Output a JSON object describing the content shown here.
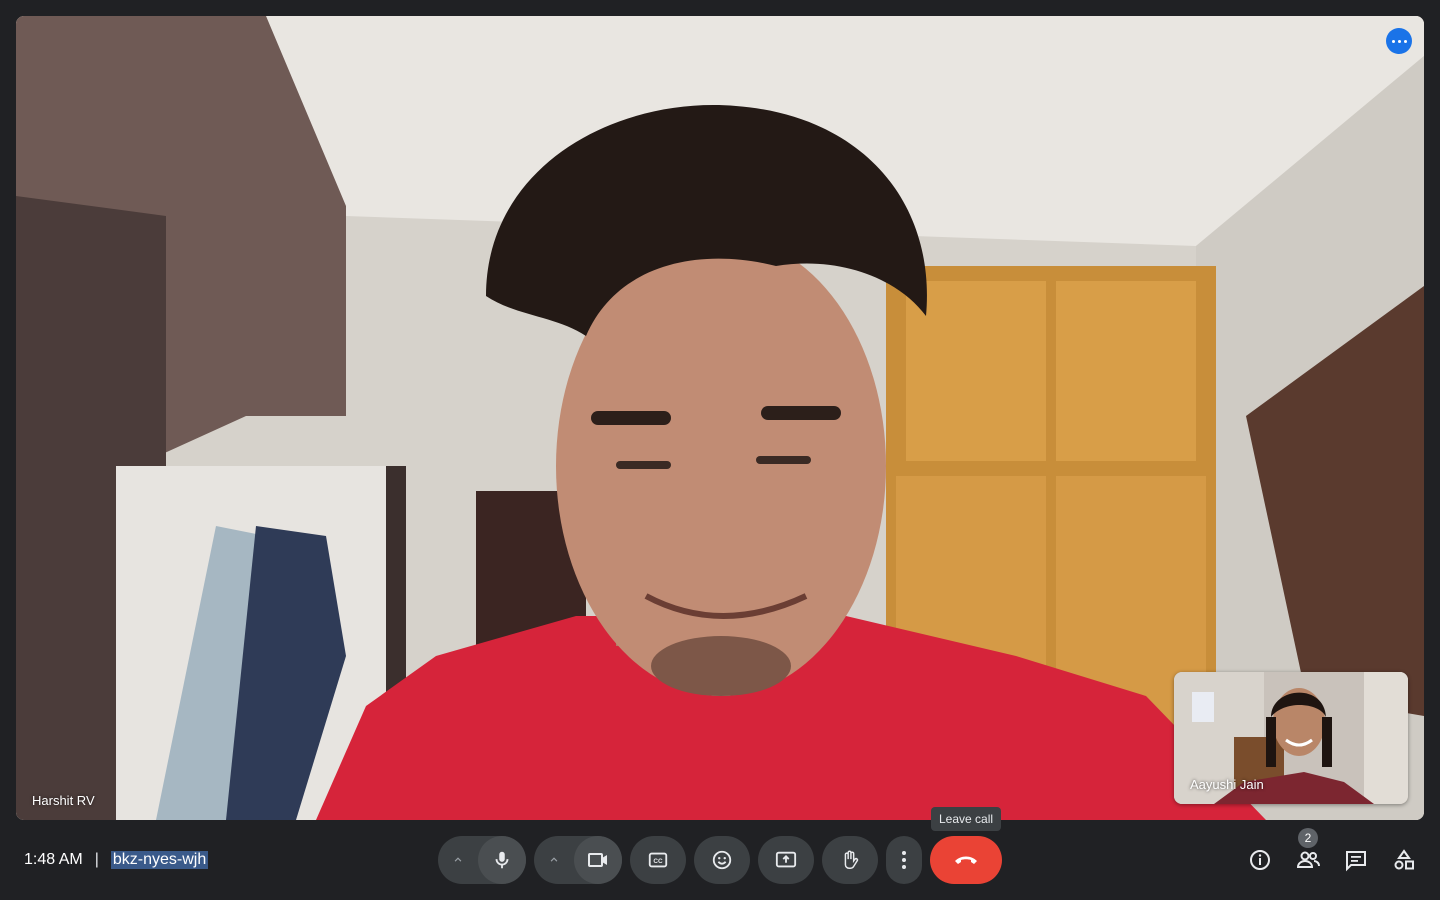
{
  "main_video": {
    "participant_name": "Harshit RV",
    "menu_icon": "more-horiz-icon"
  },
  "self_video": {
    "participant_name": "Aayushi Jain"
  },
  "meeting": {
    "time": "1:48 AM",
    "separator": "|",
    "code": "bkz-nyes-wjh"
  },
  "controls": {
    "audio_options_icon": "chevron-up-icon",
    "mic_icon": "mic-icon",
    "video_options_icon": "chevron-up-icon",
    "camera_icon": "videocam-icon",
    "captions_icon": "closed-caption-icon",
    "reactions_icon": "emoji-icon",
    "present_icon": "present-screen-icon",
    "raise_hand_icon": "hand-icon",
    "more_icon": "more-vert-icon",
    "leave_icon": "call-end-icon",
    "leave_tooltip": "Leave call"
  },
  "side_panel": {
    "info_icon": "info-icon",
    "people_icon": "people-icon",
    "people_count": "2",
    "chat_icon": "chat-icon",
    "activities_icon": "activities-icon"
  },
  "colors": {
    "background": "#202124",
    "control": "#3c4043",
    "leave": "#ea4335",
    "accent": "#1a73e8"
  }
}
